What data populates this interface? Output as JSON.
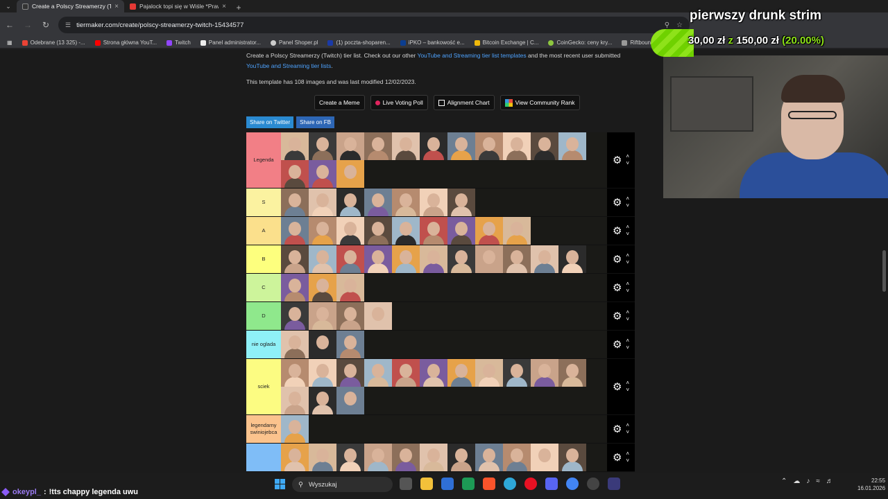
{
  "browser": {
    "tabs": [
      {
        "title": "Create a Polscy Streamerzy (Twi",
        "active": true
      },
      {
        "title": "Pajalock topi się w Wiśle *Prawi",
        "active": false
      }
    ],
    "address": "tiermaker.com/create/polscy-streamerzy-twitch-15434577",
    "bookmarks": [
      "Odebrane (13 325) -...",
      "Strona główna YouT...",
      "Twitch",
      "Panel administrator...",
      "Panel Shoper.pl",
      "(1) poczta-shoparen...",
      "iPKO – bankowość e...",
      "Bitcoin Exchange | C...",
      "CoinGecko: ceny kry...",
      "Riftbound"
    ]
  },
  "page": {
    "intro_text": "Create a Polscy Streamerzy (Twitch) tier list. Check out our other ",
    "intro_link1": "YouTube and Streaming tier list templates",
    "intro_mid": " and the most recent user submitted ",
    "intro_link2": "YouTube and Streaming tier lists",
    "intro_end": ".",
    "meta": "This template has 108 images and was last modified 12/02/2023.",
    "actions": [
      "Create a Meme",
      "Live Voting Poll",
      "Alignment Chart",
      "View Community Rank"
    ],
    "share": [
      "Share on Twitter",
      "Share on FB"
    ]
  },
  "tiers": [
    {
      "label": "Legenda",
      "color": "#f27f86",
      "count": 14
    },
    {
      "label": "S",
      "color": "#fbf2a0",
      "count": 7
    },
    {
      "label": "A",
      "color": "#fbe08c",
      "count": 9
    },
    {
      "label": "B",
      "color": "#fdff7e",
      "count": 11
    },
    {
      "label": "C",
      "color": "#cdf49b",
      "count": 3
    },
    {
      "label": "D",
      "color": "#8fe88c",
      "count": 4
    },
    {
      "label": "nie oglada",
      "color": "#8ff0f7",
      "count": 3
    },
    {
      "label": "sciek",
      "color": "#fcfc82",
      "count": 14
    },
    {
      "label": "legendarny swiniojebca",
      "color": "#fbc38d",
      "count": 1
    },
    {
      "label": "",
      "color": "#7fbdf7",
      "count": 11
    }
  ],
  "stream": {
    "title": "pierwszy drunk strim",
    "goal_current": "30,00 zł",
    "goal_sep": "z",
    "goal_target": "150,00 zł",
    "goal_pct": "(20.00%)",
    "goal_fraction": 0.2,
    "chat_user": "okeypl_",
    "chat_sep": ":",
    "chat_msg": "!tts chappy legenda uwu"
  },
  "taskbar": {
    "search_placeholder": "Wyszukaj",
    "time": "22:55",
    "date": "16.01.2026"
  }
}
